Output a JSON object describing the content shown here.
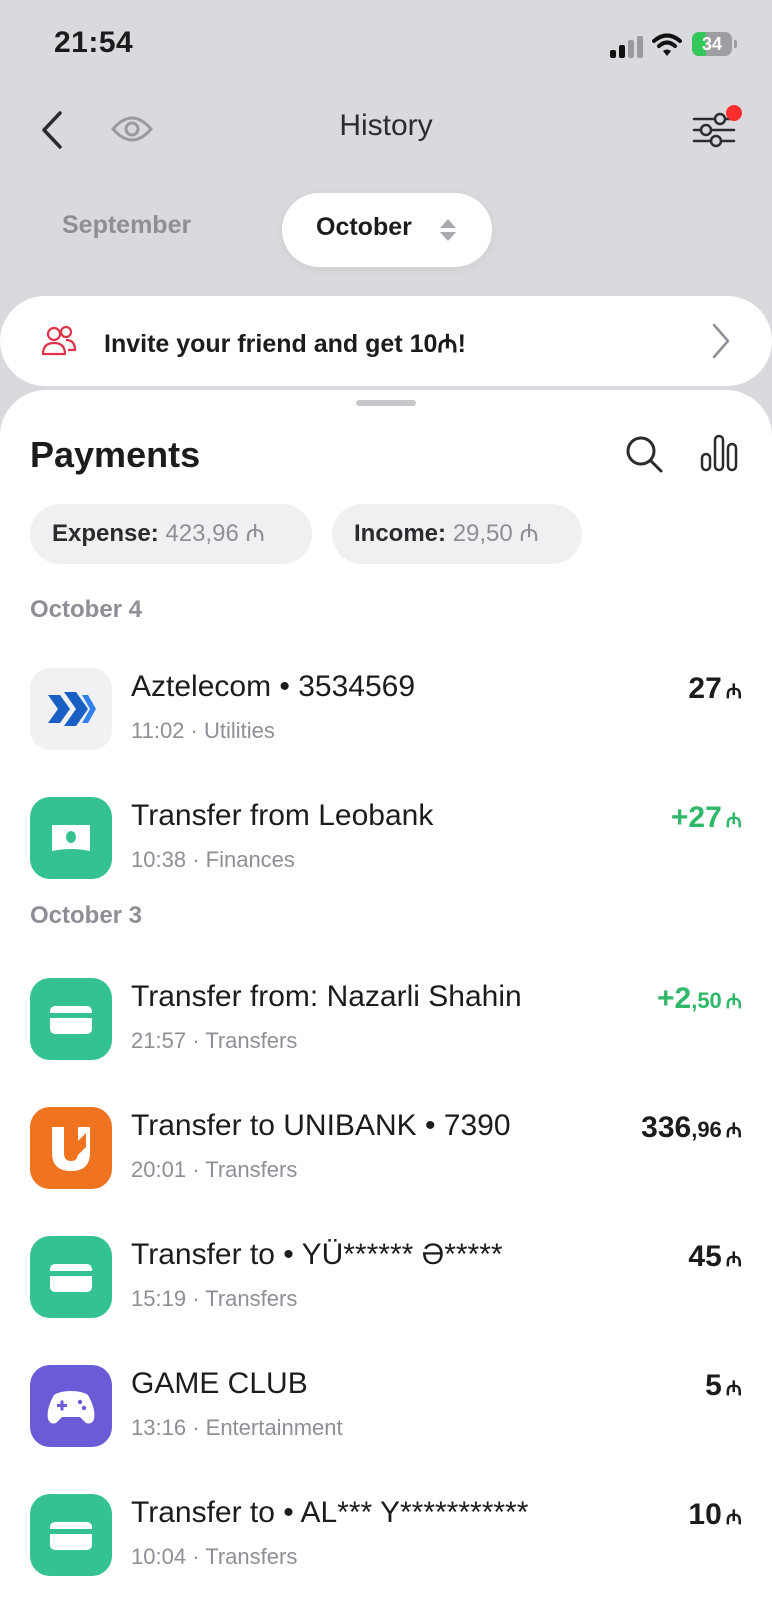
{
  "status_bar": {
    "time": "21:54",
    "battery_level": "34",
    "battery_fraction": 0.34
  },
  "header": {
    "title": "History"
  },
  "months": {
    "previous": "September",
    "current": "October"
  },
  "invite_banner": {
    "text": "Invite your friend and get 10₼!"
  },
  "payments": {
    "title": "Payments",
    "expense": {
      "label": "Expense:",
      "value": "423,96 ₼"
    },
    "income": {
      "label": "Income:",
      "value": "29,50 ₼"
    }
  },
  "groups": [
    {
      "date": "October 4",
      "items": [
        {
          "name": "Aztelecom • 3534569",
          "time": "11:02",
          "category": "Utilities",
          "amount": "27",
          "fraction": "",
          "currency": "₼",
          "positive": false,
          "icon": "aztelecom-logo-icon"
        },
        {
          "name": "Transfer from Leobank",
          "time": "10:38",
          "category": "Finances",
          "amount": "+27",
          "fraction": "",
          "currency": "₼",
          "positive": true,
          "icon": "banknote-icon"
        }
      ]
    },
    {
      "date": "October 3",
      "items": [
        {
          "name": "Transfer from: Nazarli Shahin",
          "time": "21:57",
          "category": "Transfers",
          "amount": "+2",
          "fraction": ",50",
          "currency": "₼",
          "positive": true,
          "icon": "card-icon"
        },
        {
          "name": "Transfer to UNIBANK • 7390",
          "time": "20:01",
          "category": "Transfers",
          "amount": "336",
          "fraction": ",96",
          "currency": "₼",
          "positive": false,
          "icon": "unibank-logo-icon"
        },
        {
          "name": "Transfer to  • YÜ****** Ə*****",
          "time": "15:19",
          "category": "Transfers",
          "amount": "45",
          "fraction": "",
          "currency": "₼",
          "positive": false,
          "icon": "card-icon"
        },
        {
          "name": "GAME CLUB",
          "time": "13:16",
          "category": "Entertainment",
          "amount": "5",
          "fraction": "",
          "currency": "₼",
          "positive": false,
          "icon": "gamepad-icon"
        },
        {
          "name": "Transfer to  • AL*** Y***********",
          "time": "10:04",
          "category": "Transfers",
          "amount": "10",
          "fraction": "",
          "currency": "₼",
          "positive": false,
          "icon": "card-icon"
        }
      ]
    }
  ],
  "meta_separator": "·",
  "colors": {
    "background": "#d9d9de",
    "positive": "#2fb86a",
    "transfer_icon": "#35c291",
    "unibank": "#f0731f",
    "game_club": "#6a5bd6",
    "notification_dot": "#ff2d2d"
  }
}
